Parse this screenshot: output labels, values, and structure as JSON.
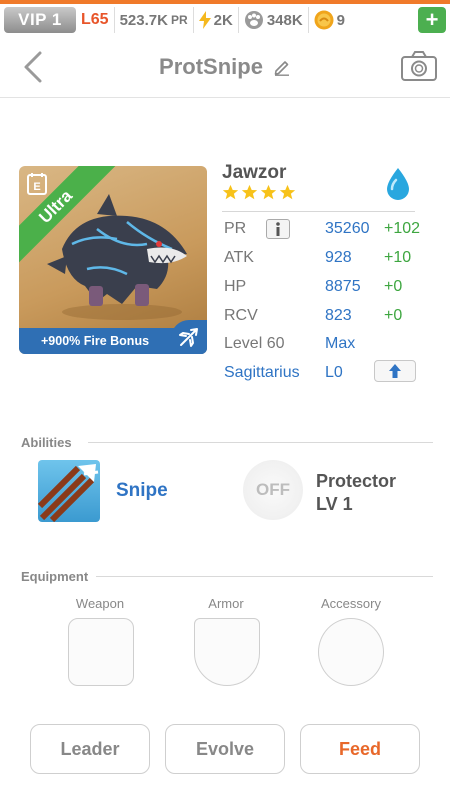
{
  "statusbar": {
    "vip": "VIP 1",
    "level": "L65",
    "power": "523.7K",
    "power_suffix": "PR",
    "energy": "2K",
    "food": "348K",
    "coins": "9",
    "plus": "+",
    "accent_color": "#f07a2a"
  },
  "header": {
    "title": "ProtSnipe",
    "back_icon": "chevron-left-icon",
    "edit_icon": "pencil-icon",
    "camera_icon": "camera-icon"
  },
  "monster": {
    "rarity": "Ultra",
    "bonus": "+900% Fire Bonus",
    "name": "Jawzor",
    "stars": 4,
    "element_icon": "water-drop-icon",
    "stats": [
      {
        "label": "PR",
        "value": "35260",
        "gain": "+102"
      },
      {
        "label": "ATK",
        "value": "928",
        "gain": "+10"
      },
      {
        "label": "HP",
        "value": "8875",
        "gain": "+0"
      },
      {
        "label": "RCV",
        "value": "823",
        "gain": "+0"
      }
    ],
    "level_label": "Level 60",
    "level_value": "Max",
    "zodiac": "Sagittarius",
    "zodiac_level": "L0"
  },
  "abilities": {
    "title": "Abilities",
    "skill_name": "Snipe",
    "off_label": "OFF",
    "passive_name": "Protector",
    "passive_level": "LV 1"
  },
  "equipment": {
    "title": "Equipment",
    "slots": [
      "Weapon",
      "Armor",
      "Accessory"
    ]
  },
  "actions": {
    "leader": "Leader",
    "evolve": "Evolve",
    "feed": "Feed"
  },
  "colors": {
    "blue": "#2f74c4",
    "green": "#3ea640",
    "orange": "#e8682a",
    "ultra_ribbon": "#4bb04a"
  }
}
